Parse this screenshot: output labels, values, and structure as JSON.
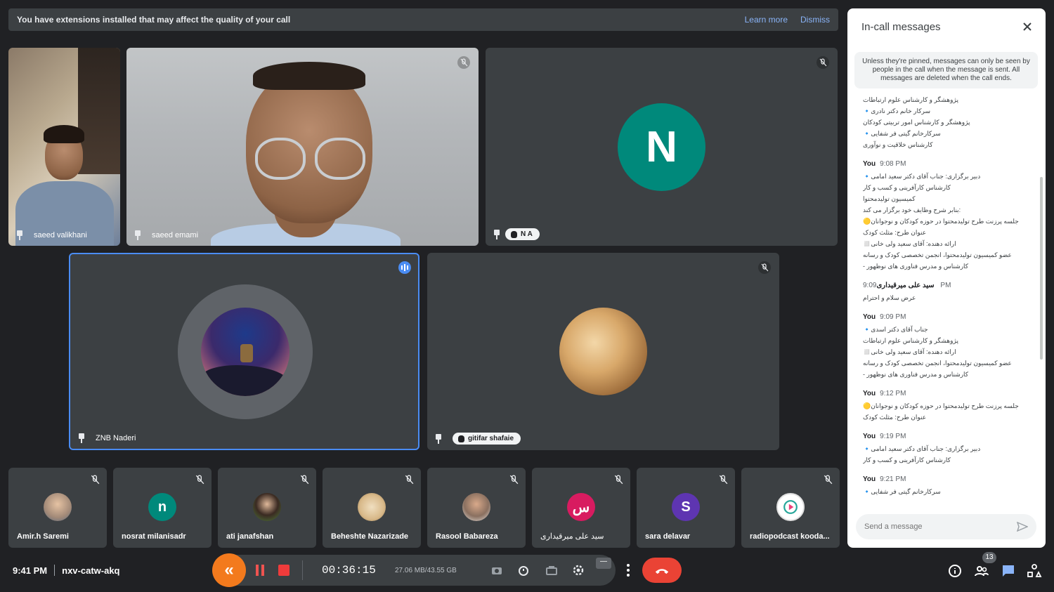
{
  "banner": {
    "text": "You have extensions installed that may affect the quality of your call",
    "learn_more": "Learn more",
    "dismiss": "Dismiss"
  },
  "tiles": {
    "saeed_v": {
      "name": "saeed valikhani"
    },
    "saeed_e": {
      "name": "saeed emami"
    },
    "na": {
      "initial": "N",
      "name": "N A",
      "color": "#00897b"
    },
    "znb": {
      "name": "ZNB Naderi"
    },
    "gitifar": {
      "name": "gitifar shafaie"
    }
  },
  "strip": [
    {
      "name": "Amir.h Saremi",
      "avatar": "",
      "color": "#8d9aa6"
    },
    {
      "name": "nosrat milanisadr",
      "avatar": "n",
      "color": "#00897b"
    },
    {
      "name": "ati janafshan",
      "avatar": "",
      "color": "#4e7a3a"
    },
    {
      "name": "Beheshte Nazarizade",
      "avatar": "",
      "color": "#d8b98a"
    },
    {
      "name": "Rasool Babareza",
      "avatar": "",
      "color": "#c9c3bd"
    },
    {
      "name": "سید علی میرقیداری",
      "avatar": "س",
      "color": "#d81b60"
    },
    {
      "name": "sara delavar",
      "avatar": "S",
      "color": "#5e35b1"
    },
    {
      "name": "radiopodcast kooda...",
      "avatar": "",
      "color": "#ffffff"
    }
  ],
  "panel": {
    "title": "In-call messages",
    "note": "Unless they're pinned, messages can only be seen by people in the call when the message is sent. All messages are deleted when the call ends.",
    "messages": [
      {
        "sender": "",
        "time": "",
        "lines": [
          "پژوهشگر و کارشناس علوم ارتباطات",
          "سرکار خانم دکتر نادری🔹",
          "پژوهشگر و کارشناس امور تربیتی کودکان",
          "سرکارخانم گیتی فر شفایی🔹",
          "کارشناس خلاقیت و نوآوری"
        ]
      },
      {
        "sender": "You",
        "time": "9:08 PM",
        "lines": [
          "دبیر برگزاری: جناب آقای دکتر سعید امامی🔹",
          "کارشناس کارآفرینی و کسب و کار",
          "کمیسیون تولیدمحتوا",
          ":بنابر شرح وظایف خود برگزار می کند",
          "جلسه پرزنت طرح تولیدمحتوا در حوزه کودکان و نوجوانان🟡",
          "عنوان طرح: مثلث کودک",
          "ارائه دهنده: آقای سعید ولی خانی◻️",
          "عضو کمیسیون تولیدمحتوا، انجمن تخصصی کودک و رسانه",
          "کارشناس و مدرس فناوری های نوظهور -"
        ]
      },
      {
        "sender": "سید علی میرقیداری",
        "time": "9:09 PM",
        "lines": [
          "عرض سلام و احترام"
        ]
      },
      {
        "sender": "You",
        "time": "9:09 PM",
        "lines": [
          "جناب آقای دکتر اسدی🔹",
          "پژوهشگر و کارشناس علوم ارتباطات",
          "ارائه دهنده: آقای سعید ولی خانی◻️",
          "عضو کمیسیون تولیدمحتوا، انجمن تخصصی کودک و رسانه",
          "کارشناس و مدرس فناوری های نوظهور -"
        ]
      },
      {
        "sender": "You",
        "time": "9:12 PM",
        "lines": [
          "جلسه پرزنت طرح تولیدمحتوا در حوزه کودکان و نوجوانان🟡",
          "عنوان طرح: مثلث کودک"
        ]
      },
      {
        "sender": "You",
        "time": "9:19 PM",
        "lines": [
          "دبیر برگزاری: جناب آقای دکتر سعید امامی🔹",
          "کارشناس کارآفرینی و کسب و کار"
        ]
      },
      {
        "sender": "You",
        "time": "9:21 PM",
        "lines": [
          "سرکارخانم گیتی فر شفایی🔹"
        ]
      }
    ],
    "input_placeholder": "Send a message"
  },
  "footer": {
    "time": "9:41 PM",
    "meeting_code": "nxv-catw-akq",
    "people_count": "13"
  },
  "recorder": {
    "elapsed": "00:36:15",
    "size": "27.06 MB/43.55 GB",
    "min_label": "—"
  },
  "colors": {
    "accent": "#4a8cf3",
    "hangup": "#ea4335",
    "recorder_orange": "#f37a1d"
  }
}
